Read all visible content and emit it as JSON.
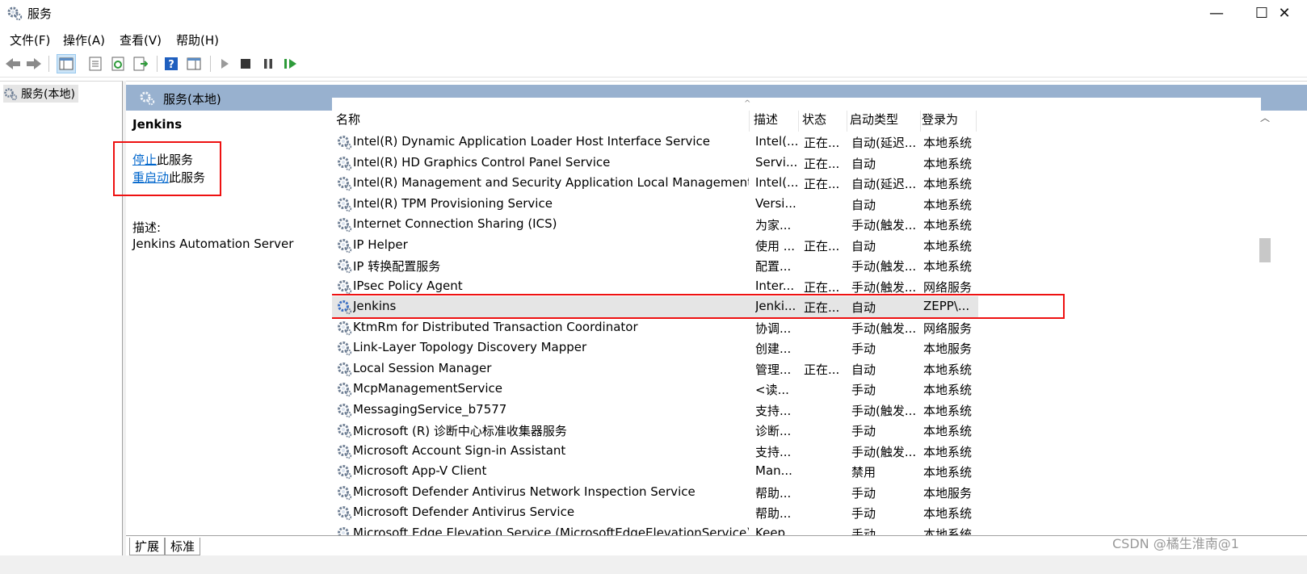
{
  "window": {
    "title": "服务",
    "minimize": "—",
    "maximize": "☐",
    "close": "✕"
  },
  "menu": [
    "文件(F)",
    "操作(A)",
    "查看(V)",
    "帮助(H)"
  ],
  "tree": {
    "root_label": "服务(本地)"
  },
  "pane": {
    "header": "服务(本地)"
  },
  "details": {
    "service_name": "Jenkins",
    "stop_link": "停止",
    "stop_suffix": "此服务",
    "restart_link": "重启动",
    "restart_suffix": "此服务",
    "desc_label": "描述:",
    "desc_text": "Jenkins Automation Server"
  },
  "columns": {
    "name": "名称",
    "desc": "描述",
    "status": "状态",
    "startup": "启动类型",
    "logon": "登录为"
  },
  "rows": [
    {
      "name": "Intel(R) Dynamic Application Loader Host Interface Service",
      "desc": "Intel(...",
      "status": "正在...",
      "startup": "自动(延迟...",
      "logon": "本地系统"
    },
    {
      "name": "Intel(R) HD Graphics Control Panel Service",
      "desc": "Servi...",
      "status": "正在...",
      "startup": "自动",
      "logon": "本地系统"
    },
    {
      "name": "Intel(R) Management and Security Application Local Management Service",
      "desc": "Intel(...",
      "status": "正在...",
      "startup": "自动(延迟...",
      "logon": "本地系统"
    },
    {
      "name": "Intel(R) TPM Provisioning Service",
      "desc": "Versi...",
      "status": "",
      "startup": "自动",
      "logon": "本地系统"
    },
    {
      "name": "Internet Connection Sharing (ICS)",
      "desc": "为家...",
      "status": "",
      "startup": "手动(触发...",
      "logon": "本地系统"
    },
    {
      "name": "IP Helper",
      "desc": "使用 ...",
      "status": "正在...",
      "startup": "自动",
      "logon": "本地系统"
    },
    {
      "name": "IP 转换配置服务",
      "desc": "配置...",
      "status": "",
      "startup": "手动(触发...",
      "logon": "本地系统"
    },
    {
      "name": "IPsec Policy Agent",
      "desc": "Inter...",
      "status": "正在...",
      "startup": "手动(触发...",
      "logon": "网络服务"
    },
    {
      "name": "Jenkins",
      "desc": "Jenki...",
      "status": "正在...",
      "startup": "自动",
      "logon": "ZEPP\\...",
      "selected": true
    },
    {
      "name": "KtmRm for Distributed Transaction Coordinator",
      "desc": "协调...",
      "status": "",
      "startup": "手动(触发...",
      "logon": "网络服务"
    },
    {
      "name": "Link-Layer Topology Discovery Mapper",
      "desc": "创建...",
      "status": "",
      "startup": "手动",
      "logon": "本地服务"
    },
    {
      "name": "Local Session Manager",
      "desc": "管理...",
      "status": "正在...",
      "startup": "自动",
      "logon": "本地系统"
    },
    {
      "name": "McpManagementService",
      "desc": "<读...",
      "status": "",
      "startup": "手动",
      "logon": "本地系统"
    },
    {
      "name": "MessagingService_b7577",
      "desc": "支持...",
      "status": "",
      "startup": "手动(触发...",
      "logon": "本地系统"
    },
    {
      "name": "Microsoft (R) 诊断中心标准收集器服务",
      "desc": "诊断...",
      "status": "",
      "startup": "手动",
      "logon": "本地系统"
    },
    {
      "name": "Microsoft Account Sign-in Assistant",
      "desc": "支持...",
      "status": "",
      "startup": "手动(触发...",
      "logon": "本地系统"
    },
    {
      "name": "Microsoft App-V Client",
      "desc": "Man...",
      "status": "",
      "startup": "禁用",
      "logon": "本地系统"
    },
    {
      "name": "Microsoft Defender Antivirus Network Inspection Service",
      "desc": "帮助...",
      "status": "",
      "startup": "手动",
      "logon": "本地服务"
    },
    {
      "name": "Microsoft Defender Antivirus Service",
      "desc": "帮助...",
      "status": "",
      "startup": "手动",
      "logon": "本地系统"
    },
    {
      "name": "Microsoft Edge Elevation Service (MicrosoftEdgeElevationService)",
      "desc": "Keep...",
      "status": "",
      "startup": "手动",
      "logon": "本地系统"
    }
  ],
  "tabs": [
    "扩展",
    "标准"
  ],
  "watermark": "CSDN @橘生淮南@1"
}
